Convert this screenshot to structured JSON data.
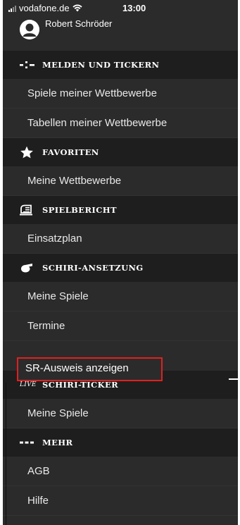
{
  "status_bar": {
    "carrier": "vodafone.de",
    "time": "13:00"
  },
  "user": {
    "name": "Robert Schröder"
  },
  "sections": [
    {
      "title": "MELDEN UND TICKERN",
      "icon": "ticker-icon",
      "items": [
        "Spiele meiner Wettbewerbe",
        "Tabellen meiner Wettbewerbe"
      ]
    },
    {
      "title": "FAVORITEN",
      "icon": "star-icon",
      "items": [
        "Meine Wettbewerbe"
      ]
    },
    {
      "title": "SPIELBERICHT",
      "icon": "report-icon",
      "items": [
        "Einsatzplan"
      ]
    },
    {
      "title": "SCHIRI-ANSETZUNG",
      "icon": "whistle-icon",
      "items": [
        "Meine Spiele",
        "Termine",
        "SR-Ausweis anzeigen"
      ]
    },
    {
      "title": "SCHIRI-TICKER",
      "icon": "live-icon",
      "icon_text": "LIVE",
      "items": [
        "Meine Spiele"
      ]
    },
    {
      "title": "MEHR",
      "icon": "more-icon",
      "items": [
        "AGB",
        "Hilfe"
      ]
    }
  ],
  "colors": {
    "drawer_bg": "#2b2b2b",
    "header_bg": "#1e1e1e",
    "highlight": "#e02020"
  }
}
